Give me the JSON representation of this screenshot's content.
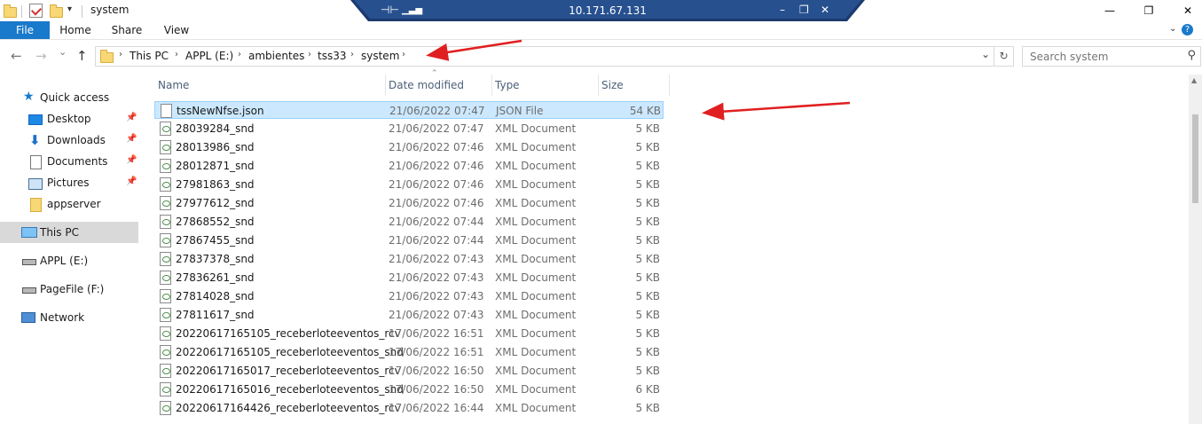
{
  "window": {
    "title": "system",
    "minimize": "—",
    "maximize": "❐",
    "close": "✕"
  },
  "rdp": {
    "host": "10.171.67.131"
  },
  "ribbon": {
    "tabs": [
      "File",
      "Home",
      "Share",
      "View"
    ],
    "help": "?"
  },
  "nav": {
    "back": "←",
    "forward": "→",
    "recent": "⌄",
    "up": "↑",
    "breadcrumb": [
      "This PC",
      "APPL (E:)",
      "ambientes",
      "tss33",
      "system"
    ],
    "dropdown": "⌄",
    "refresh": "↻",
    "search_placeholder": "Search system"
  },
  "sidebar": {
    "quick_access": "Quick access",
    "items": [
      {
        "label": "Desktop",
        "icon": "desktop-icon",
        "pinned": true
      },
      {
        "label": "Downloads",
        "icon": "downloads-icon",
        "pinned": true
      },
      {
        "label": "Documents",
        "icon": "documents-icon",
        "pinned": true
      },
      {
        "label": "Pictures",
        "icon": "pictures-icon",
        "pinned": true
      },
      {
        "label": "appserver",
        "icon": "folder-icon",
        "pinned": false
      }
    ],
    "this_pc": "This PC",
    "drives": [
      "APPL (E:)",
      "PageFile (F:)"
    ],
    "network": "Network"
  },
  "columns": [
    "Name",
    "Date modified",
    "Type",
    "Size"
  ],
  "files": [
    {
      "name": "tssNewNfse.json",
      "date": "21/06/2022 07:47",
      "type": "JSON File",
      "size": "54 KB",
      "selected": true
    },
    {
      "name": "28039284_snd",
      "date": "21/06/2022 07:47",
      "type": "XML Document",
      "size": "5 KB"
    },
    {
      "name": "28013986_snd",
      "date": "21/06/2022 07:46",
      "type": "XML Document",
      "size": "5 KB"
    },
    {
      "name": "28012871_snd",
      "date": "21/06/2022 07:46",
      "type": "XML Document",
      "size": "5 KB"
    },
    {
      "name": "27981863_snd",
      "date": "21/06/2022 07:46",
      "type": "XML Document",
      "size": "5 KB"
    },
    {
      "name": "27977612_snd",
      "date": "21/06/2022 07:46",
      "type": "XML Document",
      "size": "5 KB"
    },
    {
      "name": "27868552_snd",
      "date": "21/06/2022 07:44",
      "type": "XML Document",
      "size": "5 KB"
    },
    {
      "name": "27867455_snd",
      "date": "21/06/2022 07:44",
      "type": "XML Document",
      "size": "5 KB"
    },
    {
      "name": "27837378_snd",
      "date": "21/06/2022 07:43",
      "type": "XML Document",
      "size": "5 KB"
    },
    {
      "name": "27836261_snd",
      "date": "21/06/2022 07:43",
      "type": "XML Document",
      "size": "5 KB"
    },
    {
      "name": "27814028_snd",
      "date": "21/06/2022 07:43",
      "type": "XML Document",
      "size": "5 KB"
    },
    {
      "name": "27811617_snd",
      "date": "21/06/2022 07:43",
      "type": "XML Document",
      "size": "5 KB"
    },
    {
      "name": "20220617165105_receberloteeventos_rcv",
      "date": "17/06/2022 16:51",
      "type": "XML Document",
      "size": "5 KB"
    },
    {
      "name": "20220617165105_receberloteeventos_snd",
      "date": "17/06/2022 16:51",
      "type": "XML Document",
      "size": "5 KB"
    },
    {
      "name": "20220617165017_receberloteeventos_rcv",
      "date": "17/06/2022 16:50",
      "type": "XML Document",
      "size": "5 KB"
    },
    {
      "name": "20220617165016_receberloteeventos_snd",
      "date": "17/06/2022 16:50",
      "type": "XML Document",
      "size": "6 KB"
    },
    {
      "name": "20220617164426_receberloteeventos_rcv",
      "date": "17/06/2022 16:44",
      "type": "XML Document",
      "size": "5 KB"
    }
  ],
  "colors": {
    "file_tab": "#1979ca",
    "selection": "#cce8ff",
    "annotation_arrow": "#e02020",
    "rdp_bar": "#1c3a6e"
  }
}
